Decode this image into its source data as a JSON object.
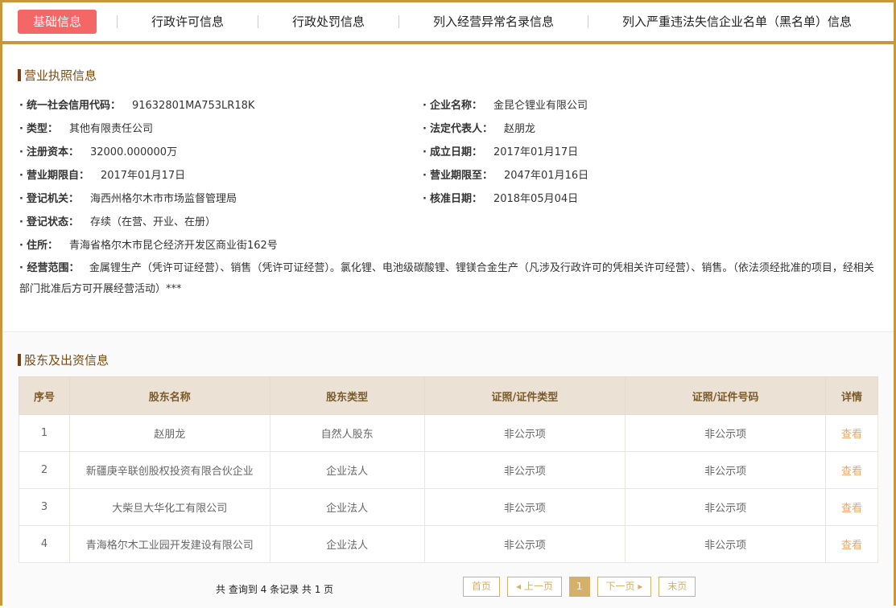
{
  "tabs": [
    "基础信息",
    "行政许可信息",
    "行政处罚信息",
    "列入经营异常名录信息",
    "列入严重违法失信企业名单（黑名单）信息"
  ],
  "license": {
    "title": "营业执照信息",
    "fields": [
      {
        "label": "统一社会信用代码：",
        "value": "91632801MA753LR18K"
      },
      {
        "label": "企业名称：",
        "value": "金昆仑锂业有限公司"
      },
      {
        "label": "类型：",
        "value": "其他有限责任公司"
      },
      {
        "label": "法定代表人：",
        "value": "赵朋龙"
      },
      {
        "label": "注册资本：",
        "value": "32000.000000万"
      },
      {
        "label": "成立日期：",
        "value": "2017年01月17日"
      },
      {
        "label": "营业期限自：",
        "value": "2017年01月17日"
      },
      {
        "label": "营业期限至：",
        "value": "2047年01月16日"
      },
      {
        "label": "登记机关：",
        "value": "海西州格尔木市市场监督管理局"
      },
      {
        "label": "核准日期：",
        "value": "2018年05月04日"
      },
      {
        "label": "登记状态：",
        "value": "存续（在营、开业、在册）"
      },
      {
        "label": "住所：",
        "value": "青海省格尔木市昆仑经济开发区商业街162号"
      }
    ],
    "scope_label": "经营范围：",
    "scope_value": "金属锂生产（凭许可证经营）、销售（凭许可证经营）。氯化锂、电池级碳酸锂、锂镁合金生产（凡涉及行政许可的凭相关许可经营）、销售。（依法须经批准的项目，经相关部门批准后方可开展经营活动）***"
  },
  "shareholders": {
    "title": "股东及出资信息",
    "headers": [
      "序号",
      "股东名称",
      "股东类型",
      "证照/证件类型",
      "证照/证件号码",
      "详情"
    ],
    "rows": [
      [
        "1",
        "赵朋龙",
        "自然人股东",
        "非公示项",
        "非公示项",
        "查看"
      ],
      [
        "2",
        "新疆庚辛联创股权投资有限合伙企业",
        "企业法人",
        "非公示项",
        "非公示项",
        "查看"
      ],
      [
        "3",
        "大柴旦大华化工有限公司",
        "企业法人",
        "非公示项",
        "非公示项",
        "查看"
      ],
      [
        "4",
        "青海格尔木工业园开发建设有限公司",
        "企业法人",
        "非公示项",
        "非公示项",
        "查看"
      ]
    ],
    "total": "共 查询到 4 条记录 共 1 页",
    "pager": {
      "first": "首页",
      "prev": "◂ 上一页",
      "current": "1",
      "next": "下一页 ▸",
      "last": "末页"
    }
  }
}
